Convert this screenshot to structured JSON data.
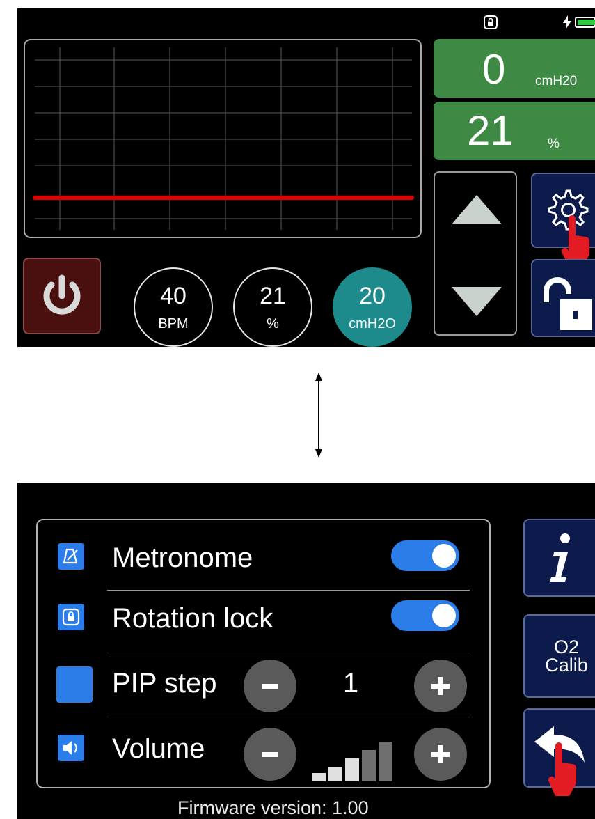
{
  "main_screen": {
    "readouts": {
      "pressure": {
        "value": "0",
        "unit": "cmH20"
      },
      "oxygen": {
        "value": "21",
        "unit": "%"
      }
    },
    "parameters": [
      {
        "value": "40",
        "unit": "BPM",
        "selected": false
      },
      {
        "value": "21",
        "unit": "%",
        "selected": false
      },
      {
        "value": "20",
        "unit": "cmH2O",
        "selected": true
      }
    ],
    "icons": [
      "rotation-lock-icon",
      "charging-icon",
      "battery-icon",
      "settings-gear-icon",
      "lock-icon",
      "power-icon",
      "up-arrow-icon",
      "down-arrow-icon",
      "tap-hand-icon"
    ],
    "colors": {
      "readout_bg": "#3e8a45",
      "selected_param": "#1d8b8b",
      "trace": "#e00000",
      "power_bg": "#4a1010",
      "side_button_bg": "#0c1a4c"
    }
  },
  "settings_screen": {
    "rows": [
      {
        "label": "Metronome",
        "control": "toggle",
        "on": true
      },
      {
        "label": "Rotation lock",
        "control": "toggle",
        "on": true
      },
      {
        "label": "PIP step",
        "control": "stepper",
        "value": "1"
      },
      {
        "label": "Volume",
        "control": "level",
        "level": 3,
        "max": 5
      }
    ],
    "o2_calibration_label": "O2 Calib",
    "firmware": "Firmware version: 1.00",
    "icons": [
      "metronome-icon",
      "rotation-lock-icon",
      "speaker-icon",
      "info-icon",
      "back-arrow-icon",
      "minus-icon",
      "plus-icon",
      "tap-hand-icon"
    ],
    "colors": {
      "accent": "#2b7de9",
      "stepper_button": "#5a5a5a"
    }
  },
  "transition_arrow": "double-headed-arrow"
}
